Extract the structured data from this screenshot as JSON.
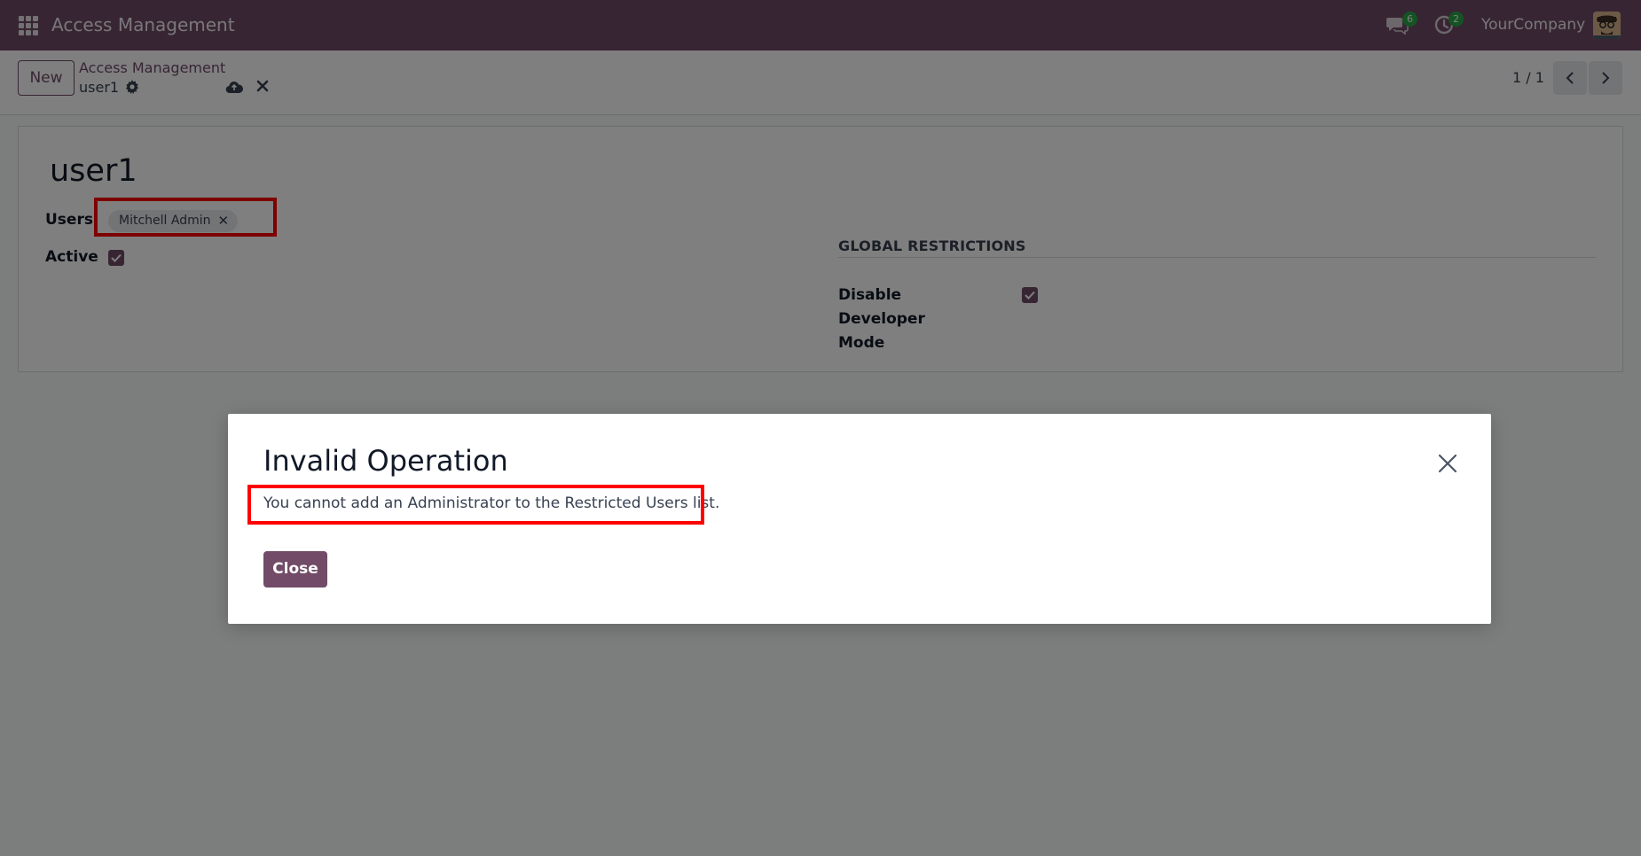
{
  "navbar": {
    "app_title": "Access Management",
    "messages_count": "6",
    "activities_count": "2",
    "company": "YourCompany"
  },
  "control_panel": {
    "new_label": "New",
    "breadcrumb_parent": "Access Management",
    "breadcrumb_current": "user1",
    "pager": "1 / 1"
  },
  "form": {
    "record_name": "user1",
    "users_label": "Users",
    "users_tags": [
      "Mitchell Admin"
    ],
    "active_label": "Active",
    "active_checked": true,
    "global_restrictions_title": "GLOBAL RESTRICTIONS",
    "disable_dev_label_line1": "Disable Developer",
    "disable_dev_label_line2": "Mode",
    "disable_dev_checked": true
  },
  "dialog": {
    "title": "Invalid Operation",
    "message": "You cannot add an Administrator to the Restricted Users list.",
    "close_label": "Close"
  },
  "colors": {
    "brand": "#714b67",
    "highlight": "#ff0000",
    "badge": "#28a745"
  }
}
